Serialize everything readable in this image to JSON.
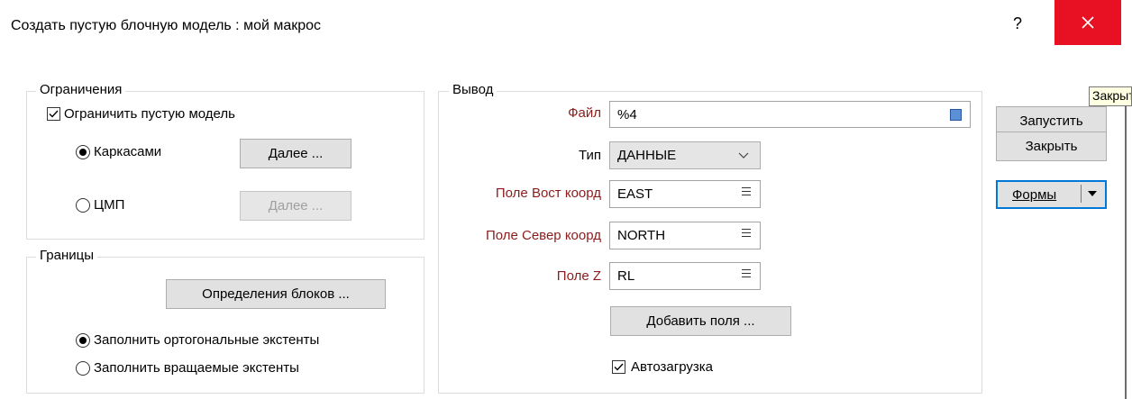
{
  "window": {
    "title": "Создать пустую блочную модель : мой макрос",
    "help_label": "?",
    "close_icon": "close-icon",
    "close_color": "#e81123",
    "tooltip": "Закрыть"
  },
  "constraints": {
    "group_label": "Ограничения",
    "constrain_label": "Ограничить пустую модель",
    "constrain_checked": true,
    "options": [
      {
        "label": "Каркасами",
        "selected": true,
        "button": "Далее ...",
        "button_enabled": true
      },
      {
        "label": "ЦМП",
        "selected": false,
        "button": "Далее ...",
        "button_enabled": false
      }
    ]
  },
  "bounds": {
    "group_label": "Границы",
    "block_defs_button": "Определения блоков ...",
    "options": [
      {
        "label": "Заполнить ортогональные экстенты",
        "selected": true
      },
      {
        "label": "Заполнить вращаемые экстенты",
        "selected": false
      }
    ]
  },
  "output": {
    "group_label": "Вывод",
    "file": {
      "label": "Файл",
      "value": "%4",
      "icon": "file-browse-icon"
    },
    "type": {
      "label": "Тип",
      "value": "ДАННЫЕ"
    },
    "east": {
      "label": "Поле Вост коорд",
      "value": "EAST"
    },
    "north": {
      "label": "Поле Север коорд",
      "value": "NORTH"
    },
    "z": {
      "label": "Поле Z",
      "value": "RL"
    },
    "add_fields_button": "Добавить поля ...",
    "autoload_label": "Автозагрузка",
    "autoload_checked": true,
    "required_label_color": "#8b1c1c"
  },
  "actions": {
    "run": "Запустить",
    "close": "Закрыть",
    "forms": "Формы",
    "focus_color": "#0078d7"
  }
}
